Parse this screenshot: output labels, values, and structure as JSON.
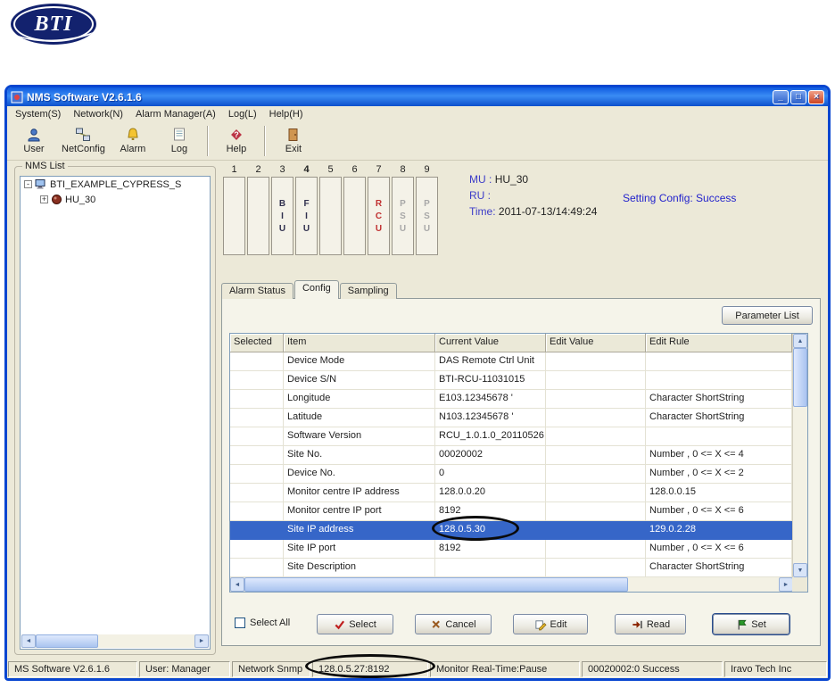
{
  "logo": {
    "text": "BTI"
  },
  "window": {
    "title": "NMS Software V2.6.1.6",
    "menus": [
      "System(S)",
      "Network(N)",
      "Alarm Manager(A)",
      "Log(L)",
      "Help(H)"
    ],
    "toolbar": [
      {
        "label": "User"
      },
      {
        "label": "NetConfig"
      },
      {
        "label": "Alarm"
      },
      {
        "label": "Log"
      },
      {
        "label": "Help"
      },
      {
        "label": "Exit"
      }
    ],
    "nms_list": {
      "label": "NMS List",
      "root_label": "BTI_EXAMPLE_CYPRESS_S",
      "child_label": "HU_30"
    },
    "slots": {
      "numbers": [
        "1",
        "2",
        "3",
        "4",
        "5",
        "6",
        "7",
        "8",
        "9"
      ],
      "cards": [
        {
          "letters": "",
          "color": "#333333"
        },
        {
          "letters": "",
          "color": "#333333"
        },
        {
          "letters": "BIU",
          "color": "#30304e"
        },
        {
          "letters": "FIU",
          "color": "#30304e"
        },
        {
          "letters": "",
          "color": "#333333"
        },
        {
          "letters": "",
          "color": "#333333"
        },
        {
          "letters": "RCU",
          "color": "#c03030"
        },
        {
          "letters": "PSU",
          "color": "#a8a8a8"
        },
        {
          "letters": "PSU",
          "color": "#a8a8a8"
        }
      ]
    },
    "info": {
      "mu_label": "MU :",
      "mu_value": "HU_30",
      "ru_label": "RU :",
      "ru_value": "",
      "time_label": "Time:",
      "time_value": "2011-07-13/14:49:24",
      "status": "Setting Config: Success"
    },
    "tabs": [
      "Alarm Status",
      "Config",
      "Sampling"
    ],
    "active_tab": "Config",
    "parameter_list_label": "Parameter List",
    "table": {
      "columns": [
        "Selected",
        "Item",
        "Current Value",
        "Edit Value",
        "Edit Rule"
      ],
      "selected_item": "Site IP address",
      "rows": [
        {
          "selected": "",
          "item": "Device Mode",
          "current": "DAS Remote Ctrl Unit",
          "edit_value": "",
          "edit_rule": ""
        },
        {
          "selected": "",
          "item": "Device S/N",
          "current": "BTI-RCU-11031015",
          "edit_value": "",
          "edit_rule": ""
        },
        {
          "selected": "",
          "item": "Longitude",
          "current": "E103.12345678 '",
          "edit_value": "",
          "edit_rule": "Character ShortString"
        },
        {
          "selected": "",
          "item": "Latitude",
          "current": "N103.12345678 '",
          "edit_value": "",
          "edit_rule": "Character ShortString"
        },
        {
          "selected": "",
          "item": "Software Version",
          "current": "RCU_1.0.1.0_20110526",
          "edit_value": "",
          "edit_rule": ""
        },
        {
          "selected": "",
          "item": "Site No.",
          "current": "00020002",
          "edit_value": "",
          "edit_rule": "Number , 0 <= X <= 4"
        },
        {
          "selected": "",
          "item": "Device No.",
          "current": "0",
          "edit_value": "",
          "edit_rule": "Number , 0 <= X <= 2"
        },
        {
          "selected": "",
          "item": "Monitor centre IP address",
          "current": "128.0.0.20",
          "edit_value": "",
          "edit_rule": "128.0.0.15"
        },
        {
          "selected": "",
          "item": "Monitor centre IP port",
          "current": "8192",
          "edit_value": "",
          "edit_rule": "Number , 0 <= X <= 6"
        },
        {
          "selected": "",
          "item": "Site IP address",
          "current": "128.0.5.30",
          "edit_value": "",
          "edit_rule": "129.0.2.28"
        },
        {
          "selected": "",
          "item": "Site IP port",
          "current": "8192",
          "edit_value": "",
          "edit_rule": "Number , 0 <= X <= 6"
        },
        {
          "selected": "",
          "item": "Site Description",
          "current": "",
          "edit_value": "",
          "edit_rule": "Character ShortString"
        }
      ]
    },
    "footer": {
      "select_all_label": "Select All",
      "buttons": [
        "Select",
        "Cancel",
        "Edit",
        "Read",
        "Set"
      ]
    },
    "statusbar": [
      "MS Software V2.6.1.6",
      "User: Manager",
      "Network Snmp",
      "128.0.5.27:8192",
      "Monitor Real-Time:Pause",
      "00020002:0 Success",
      "Iravo Tech Inc"
    ]
  }
}
